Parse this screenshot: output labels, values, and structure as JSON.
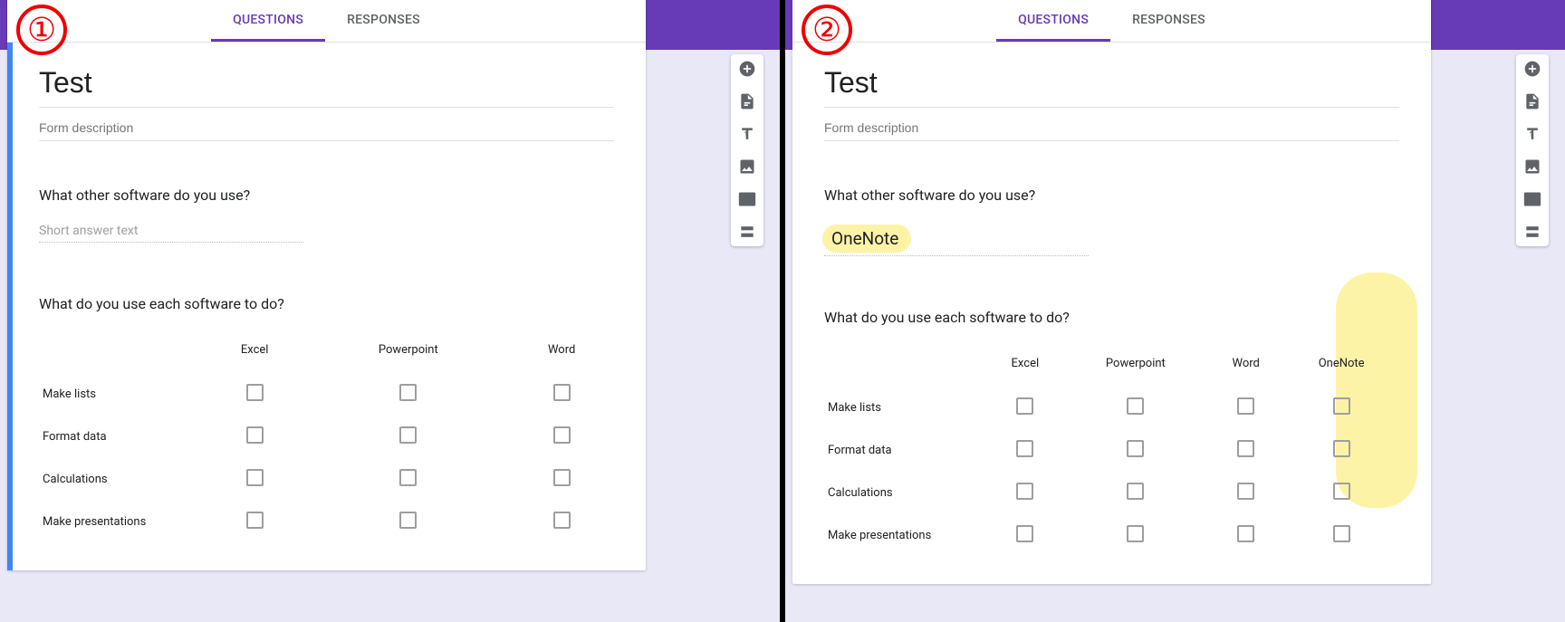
{
  "tabs": {
    "questions": "QUESTIONS",
    "responses": "RESPONSES"
  },
  "form": {
    "title": "Test",
    "desc_placeholder": "Form description"
  },
  "q1": {
    "title": "What other software do you use?",
    "short_answer_placeholder": "Short answer text",
    "sample_answer": "OneNote"
  },
  "q2": {
    "title": "What do you use each software to do?",
    "cols_a": [
      "Excel",
      "Powerpoint",
      "Word"
    ],
    "cols_b": [
      "Excel",
      "Powerpoint",
      "Word",
      "OneNote"
    ],
    "rows": [
      "Make lists",
      "Format data",
      "Calculations",
      "Make presentations"
    ]
  },
  "anno": {
    "one": "①",
    "two": "②"
  },
  "tools": [
    "add",
    "import",
    "text",
    "image",
    "video",
    "section"
  ]
}
